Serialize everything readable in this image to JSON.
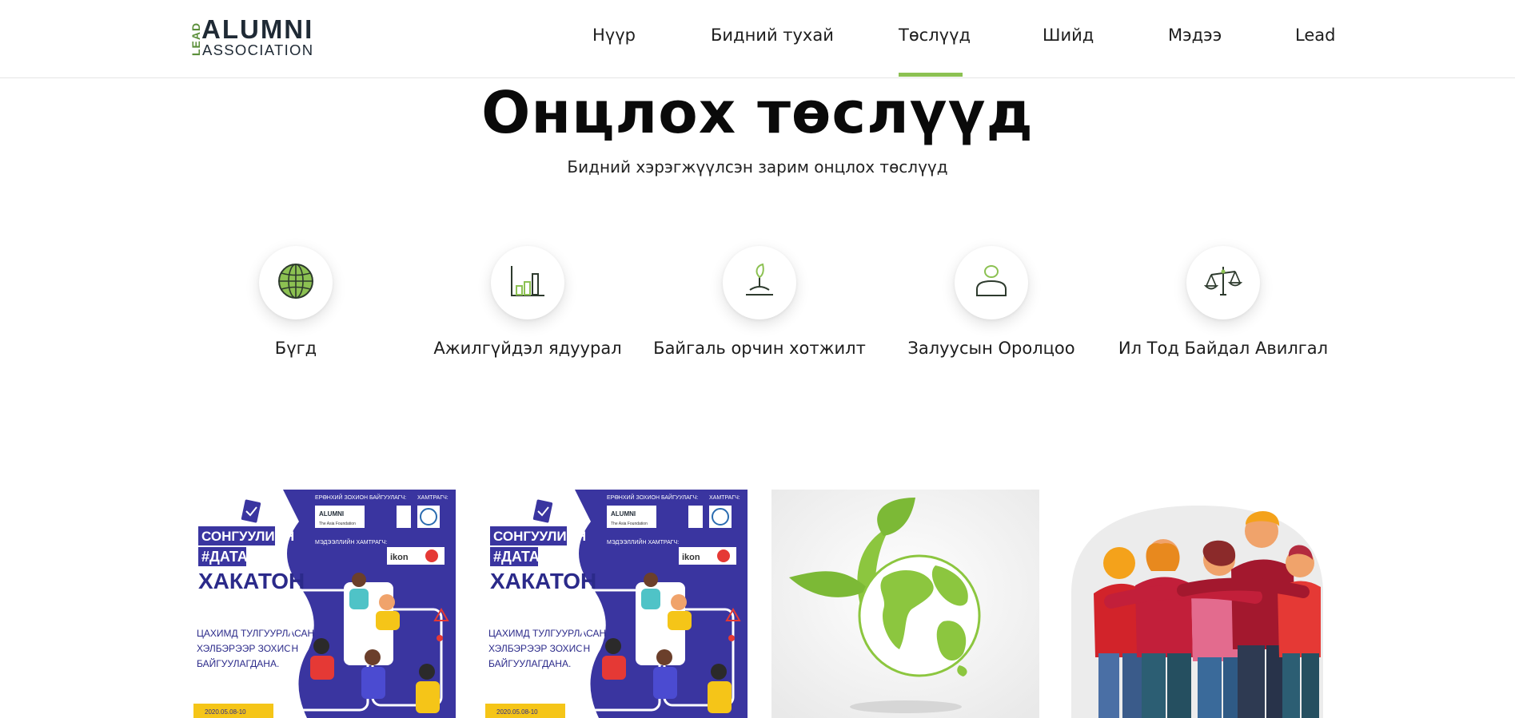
{
  "brand": {
    "logo_vertical": "LEAD",
    "logo_main": "ALUMNI",
    "logo_sub": "ASSOCIATION"
  },
  "nav": {
    "items": [
      {
        "label": "Нүүр"
      },
      {
        "label": "Бидний тухай"
      },
      {
        "label": "Төслүүд",
        "active": true
      },
      {
        "label": "Шийд"
      },
      {
        "label": "Мэдээ"
      },
      {
        "label": "Lead"
      }
    ]
  },
  "hero": {
    "title": "Онцлох төслүүд",
    "subtitle": "Бидний хэрэгжүүлсэн зарим онцлох төслүүд"
  },
  "categories": [
    {
      "label": "Бүгд",
      "icon": "globe-icon"
    },
    {
      "label": "Ажилгүйдэл ядуурал",
      "icon": "bar-chart-icon"
    },
    {
      "label": "Байгаль орчин хотжилт",
      "icon": "sprout-icon"
    },
    {
      "label": "Залуусын Оролцоо",
      "icon": "person-icon"
    },
    {
      "label": "Ил Тод Байдал Авилгал",
      "icon": "scales-icon"
    }
  ],
  "projects": [
    {
      "image": "hackathon-poster",
      "poster": {
        "line1": "СОНГУУЛИЙН",
        "line2": "#ДАТА",
        "line3": "ХАКАТОН",
        "desc1": "ЦАХИМД ТУЛГУУРЛАСАН",
        "desc2": "ХЭЛБЭРЭЭР ЗОХИОН",
        "desc3": "БАЙГУУЛАГДАНА.",
        "date": "2020.05.08-10",
        "organizer": "ЕРӨНХИЙ ЗОХИОН БАЙГУУЛАГЧ:",
        "partner": "ХАМТРАГЧ:",
        "media_partner": "МЭДЭЭЛЛИЙН ХАМТРАГЧ:",
        "org_logo": "ALUMNI",
        "foundation": "The Asia Foundation",
        "media": "ikon"
      }
    },
    {
      "image": "hackathon-poster",
      "poster": {
        "line1": "СОНГУУЛИЙН",
        "line2": "#ДАТА",
        "line3": "ХАКАТОН",
        "desc1": "ЦАХИМД ТУЛГУУРЛАСАН",
        "desc2": "ХЭЛБЭРЭЭР ЗОХИОН",
        "desc3": "БАЙГУУЛАГДАНА.",
        "date": "2020.05.08-10",
        "organizer": "ЕРӨНХИЙ ЗОХИОН БАЙГУУЛАГЧ:",
        "partner": "ХАМТРАГЧ:",
        "media_partner": "МЭДЭЭЛЛИЙН ХАМТРАГЧ:",
        "org_logo": "ALUMNI",
        "foundation": "The Asia Foundation",
        "media": "ikon"
      }
    },
    {
      "image": "green-earth-leaf"
    },
    {
      "image": "group-hug-illustration"
    }
  ],
  "colors": {
    "accent": "#8cc152",
    "poster_blue": "#3a35a0",
    "poster_title_blue": "#2b2a8a",
    "poster_yellow": "#f5c518",
    "earth_green": "#8cc63f"
  }
}
